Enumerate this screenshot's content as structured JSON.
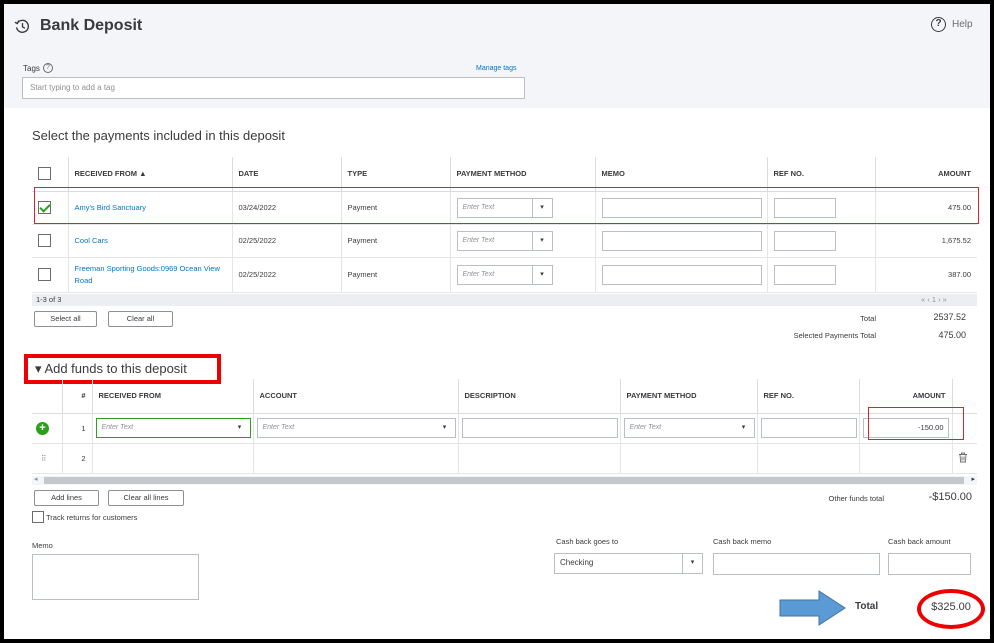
{
  "header": {
    "title": "Bank Deposit",
    "help_label": "Help"
  },
  "tags": {
    "label": "Tags",
    "manage_label": "Manage tags",
    "placeholder": "Start typing to add a tag"
  },
  "payments": {
    "section_title": "Select the payments included in this deposit",
    "columns": [
      "RECEIVED FROM ▲",
      "DATE",
      "TYPE",
      "PAYMENT METHOD",
      "MEMO",
      "REF NO.",
      "AMOUNT"
    ],
    "rows": [
      {
        "checked": true,
        "received_from": "Amy's Bird Sanctuary",
        "date": "03/24/2022",
        "type": "Payment",
        "method_placeholder": "Enter Text",
        "amount": "475.00"
      },
      {
        "checked": false,
        "received_from": "Cool Cars",
        "date": "02/25/2022",
        "type": "Payment",
        "method_placeholder": "Enter Text",
        "amount": "1,675.52"
      },
      {
        "checked": false,
        "received_from": "Freeman Sporting Goods:0969 Ocean View Road",
        "date": "02/25/2022",
        "type": "Payment",
        "method_placeholder": "Enter Text",
        "amount": "387.00"
      }
    ],
    "count_text": "1-3 of 3",
    "pager": "« ‹ 1 › »",
    "select_all": "Select all",
    "clear_all": "Clear all",
    "total_label": "Total",
    "total_value": "2537.52",
    "selected_total_label": "Selected Payments Total",
    "selected_total_value": "475.00"
  },
  "funds": {
    "section_title": "Add funds to this deposit",
    "toggle": "▾",
    "columns": [
      "#",
      "RECEIVED FROM",
      "ACCOUNT",
      "DESCRIPTION",
      "PAYMENT METHOD",
      "REF NO.",
      "AMOUNT"
    ],
    "rows": [
      {
        "num": "1",
        "received_placeholder": "Enter Text",
        "account_placeholder": "Enter Text",
        "method_placeholder": "Enter Text",
        "amount": "-150.00"
      },
      {
        "num": "2"
      }
    ],
    "add_lines": "Add lines",
    "clear_all_lines": "Clear all lines",
    "other_total_label": "Other funds total",
    "other_total_value": "-$150.00",
    "track_returns": "Track returns for customers"
  },
  "footer": {
    "memo_label": "Memo",
    "cash_back_goes_to_label": "Cash back goes to",
    "cash_back_goes_to_value": "Checking",
    "cash_back_memo_label": "Cash back memo",
    "cash_back_amount_label": "Cash back amount",
    "total_label": "Total",
    "total_value": "$325.00"
  },
  "colors": {
    "link": "#0077c5",
    "green": "#2ca01c",
    "highlight_red": "#e00000",
    "arrow_blue": "#5b9bd5"
  },
  "icons": [
    "history-icon",
    "help-icon",
    "question-icon",
    "sort-up-icon",
    "chevron-down-icon",
    "add-line-icon",
    "drag-handle-icon",
    "trash-icon",
    "arrow-right-icon"
  ]
}
